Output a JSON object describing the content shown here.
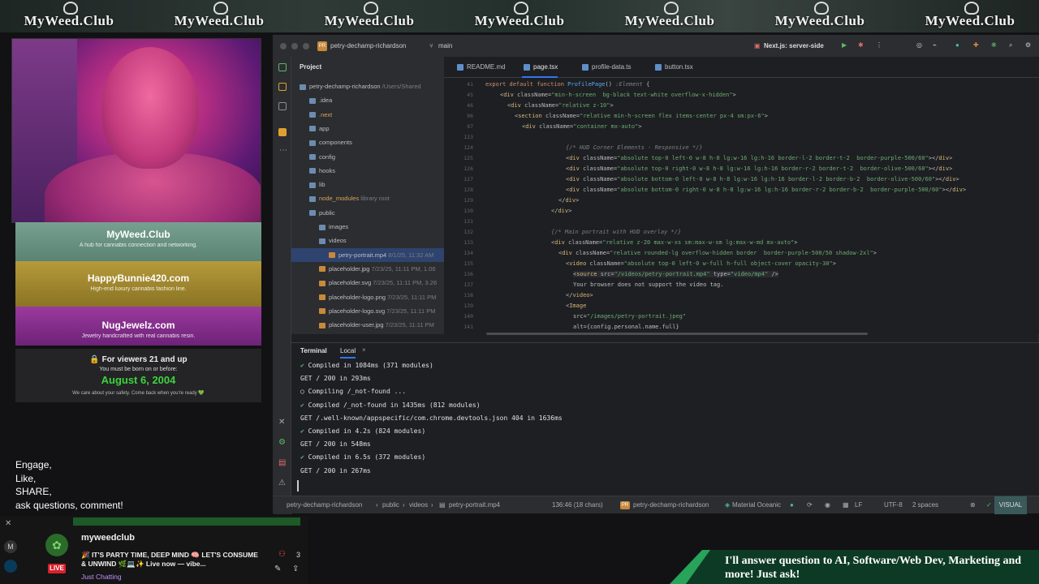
{
  "banner": {
    "brand": "MyWeed.Club"
  },
  "left": {
    "ads": [
      {
        "title": "MyWeed.Club",
        "sub": "A hub for cannabis connection and networking."
      },
      {
        "title": "HappyBunnie420.com",
        "sub": "High-end luxury cannabis fashion line."
      },
      {
        "title": "NugJewelz.com",
        "sub": "Jewelry handcrafted with real cannabis resin."
      }
    ],
    "age": {
      "heading": "🔒 For viewers 21 and up",
      "line": "You must be born on or before:",
      "date": "August 6, 2004",
      "note": "We care about your safety. Come back when you're ready 💚"
    },
    "engage": [
      "Engage,",
      "Like,",
      "SHARE,",
      "ask questions, comment!"
    ]
  },
  "ide": {
    "project": "petry-dechamp-richardson",
    "branch": "main",
    "run_config": "Next.js: server-side",
    "panel_title": "Project",
    "tree": [
      {
        "label": "petry-dechamp-richardson",
        "extra": "/Users/Shared",
        "indent": 0
      },
      {
        "label": ".idea",
        "extra": "",
        "indent": 1
      },
      {
        "label": ".next",
        "extra": "",
        "indent": 1
      },
      {
        "label": "app",
        "extra": "",
        "indent": 1
      },
      {
        "label": "components",
        "extra": "",
        "indent": 1
      },
      {
        "label": "config",
        "extra": "",
        "indent": 1
      },
      {
        "label": "hooks",
        "extra": "",
        "indent": 1
      },
      {
        "label": "lib",
        "extra": "",
        "indent": 1
      },
      {
        "label": "node_modules",
        "extra": "library root",
        "indent": 1
      },
      {
        "label": "public",
        "extra": "",
        "indent": 1
      },
      {
        "label": "images",
        "extra": "",
        "indent": 2
      },
      {
        "label": "videos",
        "extra": "",
        "indent": 2
      },
      {
        "label": "petry-portrait.mp4",
        "extra": "8/1/25, 11:32 AM",
        "indent": 3
      },
      {
        "label": "placeholder.jpg",
        "extra": "7/23/25, 11:11 PM, 1.06",
        "indent": 2
      },
      {
        "label": "placeholder.svg",
        "extra": "7/23/25, 11:11 PM, 3.26",
        "indent": 2
      },
      {
        "label": "placeholder-logo.png",
        "extra": "7/23/25, 11:11 PM",
        "indent": 2
      },
      {
        "label": "placeholder-logo.svg",
        "extra": "7/23/25, 11:11 PM",
        "indent": 2
      },
      {
        "label": "placeholder-user.jpg",
        "extra": "7/23/25, 11:11 PM",
        "indent": 2
      }
    ],
    "tabs": [
      "README.md",
      "page.tsx",
      "profile-data.ts",
      "button.tsx"
    ],
    "terminal_tabs": [
      "Terminal",
      "Local"
    ],
    "terminal": [
      {
        "ok": true,
        "text": "Compiled in 1084ms (371 modules)"
      },
      {
        "ok": false,
        "text": "GET / 200 in 293ms"
      },
      {
        "ok": false,
        "text": "○ Compiling /_not-found ..."
      },
      {
        "ok": true,
        "text": "Compiled /_not-found in 1435ms (812 modules)"
      },
      {
        "ok": false,
        "text": "GET /.well-known/appspecific/com.chrome.devtools.json 404 in 1636ms"
      },
      {
        "ok": true,
        "text": "Compiled in 4.2s (824 modules)"
      },
      {
        "ok": false,
        "text": "GET / 200 in 548ms"
      },
      {
        "ok": true,
        "text": "Compiled in 6.5s (372 modules)"
      },
      {
        "ok": false,
        "text": "GET / 200 in 267ms"
      }
    ],
    "status": {
      "breadcrumb": [
        "petry-dechamp-richardson",
        "public",
        "videos",
        "petry-portrait.mp4"
      ],
      "pos": "136:46 (18 chars)",
      "theme": "Material Oceanic",
      "eol": "LF",
      "enc": "UTF-8",
      "indent": "2 spaces",
      "mode": "VISUAL"
    },
    "line_numbers": [
      "41",
      "45",
      "46",
      "96",
      "97",
      "123",
      "124",
      "125",
      "126",
      "127",
      "128",
      "129",
      "130",
      "131",
      "132",
      "133",
      "134",
      "135",
      "136",
      "137",
      "138",
      "139",
      "140",
      "141"
    ]
  },
  "stream": {
    "channel": "myweedclub",
    "title": "🎉 IT'S PARTY TIME, DEEP MIND 🧠 LET'S CONSUME & UNWIND 🌿💻✨ Live now — vibe...",
    "category": "Just Chatting",
    "live": "LIVE",
    "viewers": "3",
    "cta": "I'll answer question to AI, Software/Web Dev, Marketing and more! Just ask!"
  }
}
